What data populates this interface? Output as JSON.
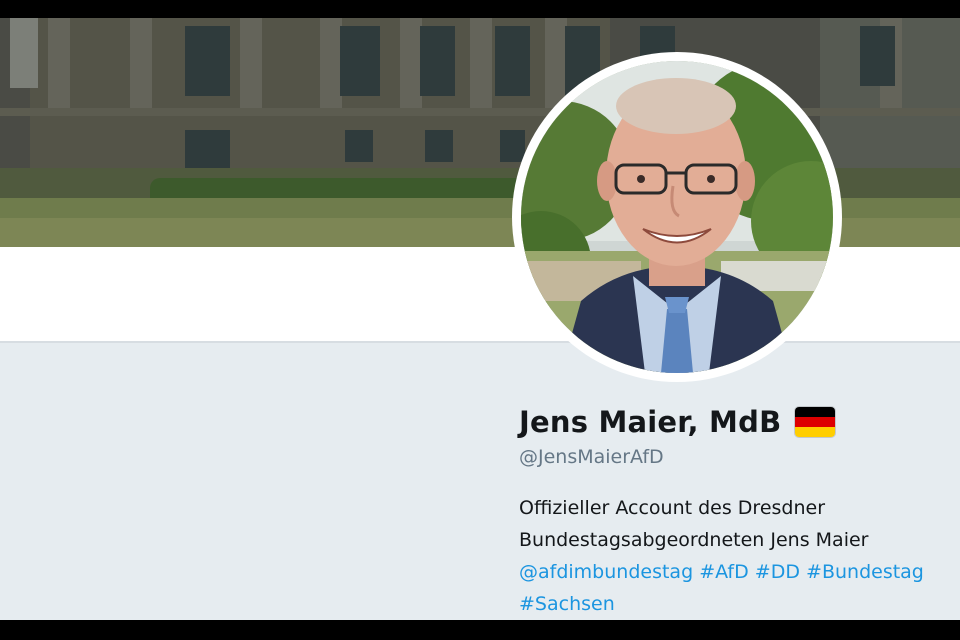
{
  "profile": {
    "name": "Jens Maier, MdB",
    "flag_emoji": "germany-flag",
    "handle": "@JensMaierAfD",
    "bio_line1": "Offizieller Account des Dresdner",
    "bio_line2": "Bundestagsabgeordneten Jens Maier",
    "links": [
      "@afdimbundestag",
      "#AfD",
      "#DD",
      "#Bundestag",
      "#Sachsen"
    ]
  },
  "colors": {
    "link": "#1b95e0",
    "name": "#14171a",
    "handle": "#657786",
    "background": "#e6ecf0",
    "flag_black": "#000000",
    "flag_red": "#dd0000",
    "flag_gold": "#ffce00"
  }
}
